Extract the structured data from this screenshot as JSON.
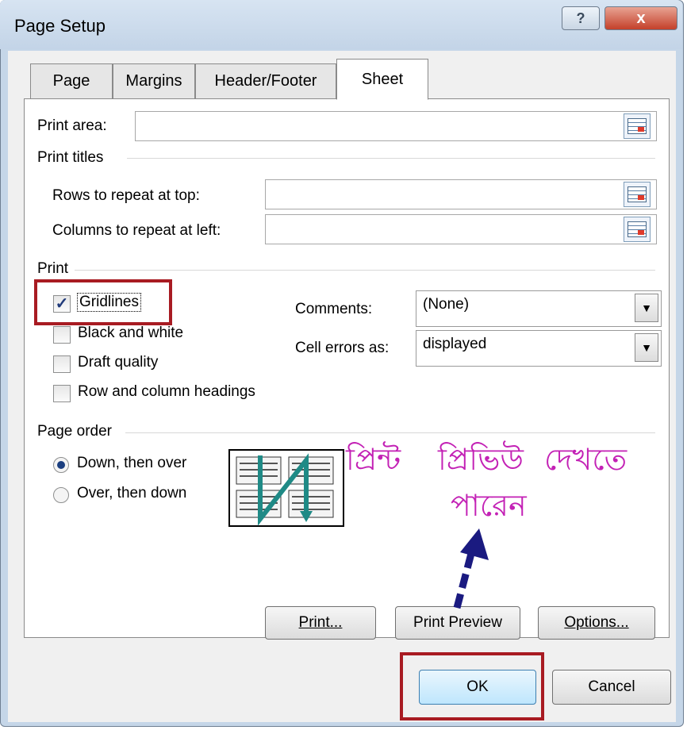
{
  "window": {
    "title": "Page Setup",
    "help_label": "?",
    "close_label": "x"
  },
  "tabs": [
    {
      "label": "Page",
      "active": false
    },
    {
      "label": "Margins",
      "active": false
    },
    {
      "label": "Header/Footer",
      "active": false
    },
    {
      "label": "Sheet",
      "active": true
    }
  ],
  "print_area": {
    "label": "Print area:",
    "value": ""
  },
  "print_titles": {
    "heading": "Print titles",
    "rows_label": "Rows to repeat at top:",
    "rows_value": "",
    "cols_label": "Columns to repeat at left:",
    "cols_value": ""
  },
  "print": {
    "heading": "Print",
    "gridlines": {
      "label": "Gridlines",
      "checked": true
    },
    "black_white": {
      "label": "Black and white",
      "checked": false
    },
    "draft_quality": {
      "label": "Draft quality",
      "checked": false
    },
    "row_col_headings": {
      "label": "Row and column headings",
      "checked": false
    },
    "comments_label": "Comments:",
    "comments_value": "(None)",
    "cell_errors_label": "Cell errors as:",
    "cell_errors_value": "displayed"
  },
  "page_order": {
    "heading": "Page order",
    "down_then_over": {
      "label": "Down, then over",
      "selected": true
    },
    "over_then_down": {
      "label": "Over, then down",
      "selected": false
    }
  },
  "annotation": {
    "line1_word1": "প্রিন্ট",
    "line1_word2": "প্রিভিউ",
    "line1_word3": "দেখতে",
    "line2": "পারেন",
    "color": "#c321b5",
    "arrow_color": "#1a1a80"
  },
  "buttons": {
    "print": "Print...",
    "print_preview": "Print Preview",
    "options": "Options...",
    "ok": "OK",
    "cancel": "Cancel"
  },
  "colors": {
    "highlight_box": "#a81b22",
    "titlebar": "#c5d6e8",
    "close": "#c4402a"
  }
}
